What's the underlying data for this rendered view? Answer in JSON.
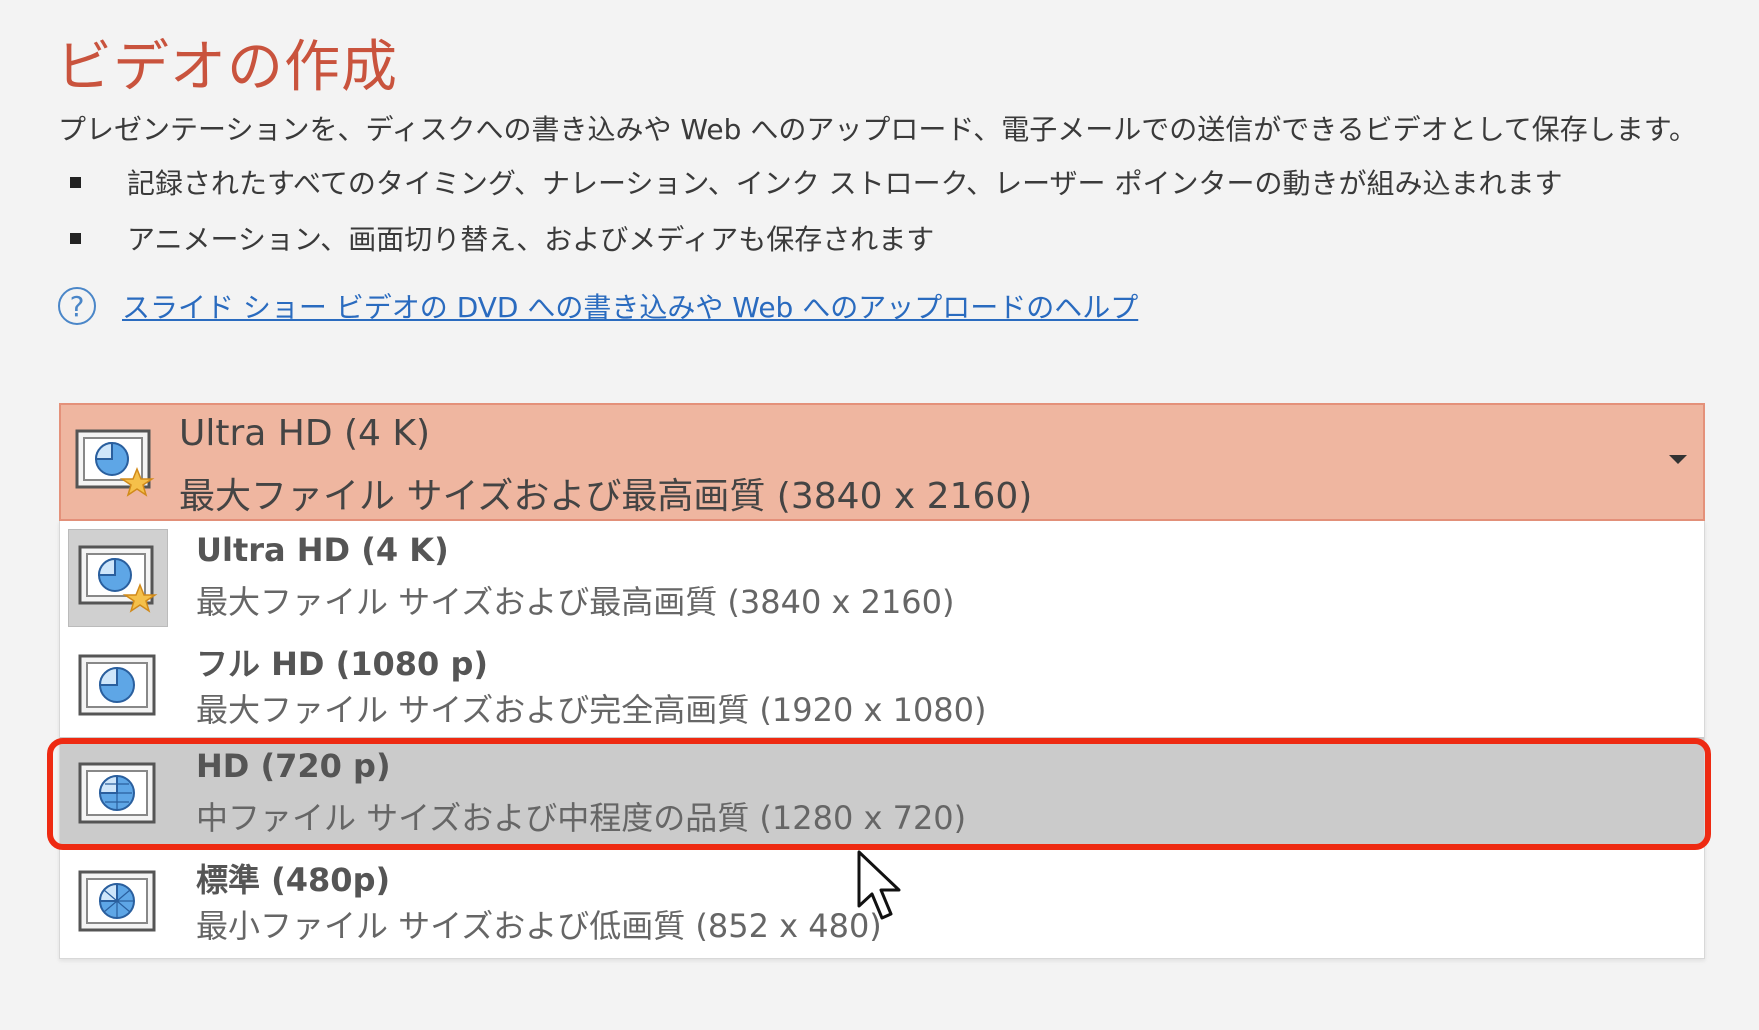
{
  "page": {
    "title": "ビデオの作成",
    "description": "プレゼンテーションを、ディスクへの書き込みや Web へのアップロード、電子メールでの送信ができるビデオとして保存します。",
    "bullets": [
      "記録されたすべてのタイミング、ナレーション、インク ストローク、レーザー ポインターの動きが組み込まれます",
      "アニメーション、画面切り替え、およびメディアも保存されます"
    ],
    "help_link": "スライド ショー ビデオの DVD への書き込みや Web へのアップロードのヘルプ"
  },
  "quality_select": {
    "selected_title": "Ultra HD (4 K)",
    "selected_desc": "最大ファイル サイズおよび最高画質 (3840 x 2160)",
    "options": [
      {
        "title": "Ultra HD (4 K)",
        "desc": "最大ファイル サイズおよび最高画質 (3840 x 2160)"
      },
      {
        "title": "フル HD (1080 p)",
        "desc": "最大ファイル サイズおよび完全高画質 (1920 x 1080)"
      },
      {
        "title": "HD (720 p)",
        "desc": "中ファイル サイズおよび中程度の品質 (1280 x 720)"
      },
      {
        "title": "標準 (480p)",
        "desc": "最小ファイル サイズおよび低画質 (852 x 480)"
      }
    ]
  },
  "colors": {
    "title": "#c9533d",
    "select_bg": "#efb6a0",
    "hover_bg": "#cbcbcb",
    "highlight_frame": "#ee2a12",
    "link": "#2a6bbf"
  },
  "icons": {
    "help": "help-circle-icon",
    "quality": "slide-video-icon",
    "star": "star-icon",
    "dropdown": "chevron-down-icon",
    "cursor": "mouse-pointer-icon"
  }
}
